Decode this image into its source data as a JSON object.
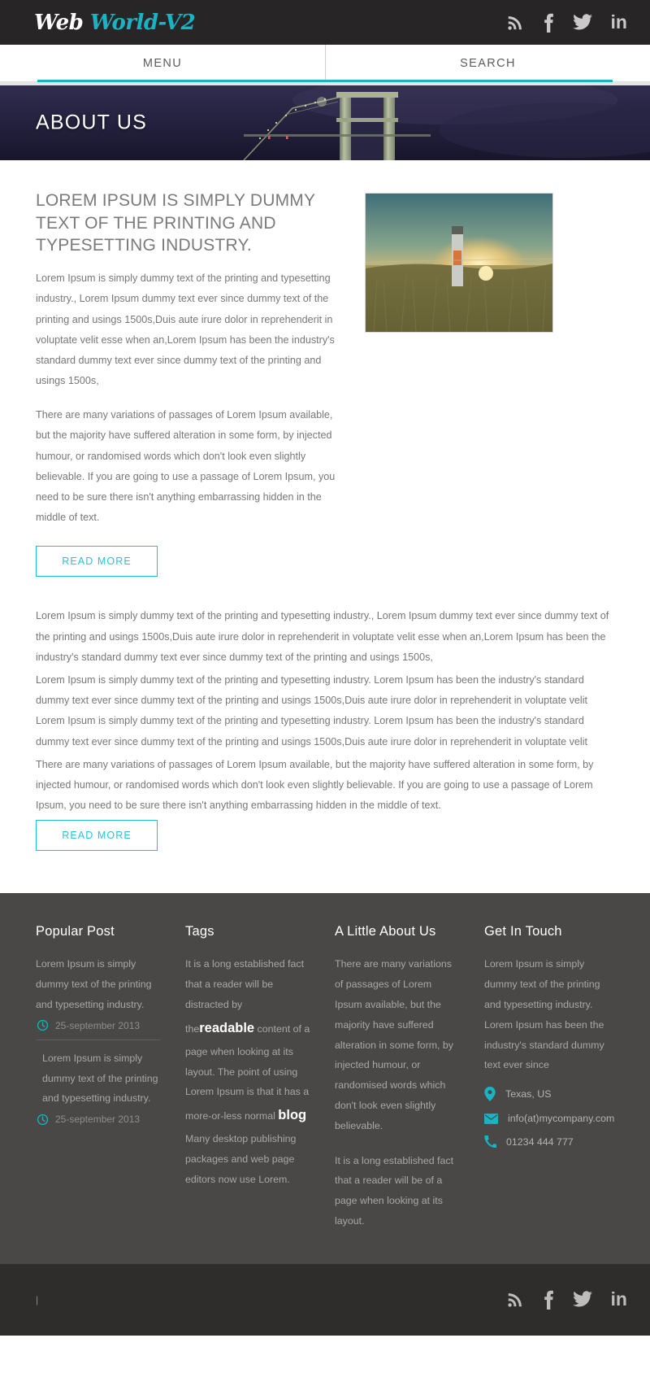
{
  "header": {
    "logo_part1": "Web ",
    "logo_part2": "World-V2",
    "social": [
      {
        "name": "rss-icon",
        "label": "RSS"
      },
      {
        "name": "facebook-icon",
        "label": "f"
      },
      {
        "name": "twitter-icon",
        "label": "Twitter"
      },
      {
        "name": "linkedin-icon",
        "label": "in"
      }
    ]
  },
  "nav": {
    "menu_label": "MENU",
    "search_label": "SEARCH",
    "accent_color": "#17b5c6"
  },
  "hero": {
    "title": "ABOUT US"
  },
  "main": {
    "headline": "LOREM IPSUM IS SIMPLY DUMMY TEXT OF THE PRINTING AND TYPESETTING INDUSTRY.",
    "paragraph1": "Lorem Ipsum is simply dummy text of the printing and typesetting industry., Lorem Ipsum dummy text ever since dummy text of the printing and usings 1500s,Duis aute irure dolor in reprehenderit in voluptate velit esse when an,Lorem Ipsum has been the industry's standard dummy text ever since dummy text of the printing and usings 1500s,",
    "paragraph2": "There are many variations of passages of Lorem Ipsum available, but the majority have suffered alteration in some form, by injected humour, or randomised words which don't look even slightly believable. If you are going to use a passage of Lorem Ipsum, you need to be sure there isn't anything embarrassing hidden in the middle of text.",
    "read_more_1": "READ MORE",
    "full_paragraph1": "Lorem Ipsum is simply dummy text of the printing and typesetting industry., Lorem Ipsum dummy text ever since dummy text of the printing and usings 1500s,Duis aute irure dolor in reprehenderit in voluptate velit esse when an,Lorem Ipsum has been the industry's standard dummy text ever since dummy text of the printing and usings 1500s,",
    "full_paragraph2": "Lorem Ipsum is simply dummy text of the printing and typesetting industry. Lorem Ipsum has been the industry's standard dummy text ever since dummy text of the printing and usings 1500s,Duis aute irure dolor in reprehenderit in voluptate velit Lorem Ipsum is simply dummy text of the printing and typesetting industry. Lorem Ipsum has been the industry's standard dummy text ever since dummy text of the printing and usings 1500s,Duis aute irure dolor in reprehenderit in voluptate velit",
    "full_paragraph3": "There are many variations of passages of Lorem Ipsum available, but the majority have suffered alteration in some form, by injected humour, or randomised words which don't look even slightly believable. If you are going to use a passage of Lorem Ipsum, you need to be sure there isn't anything embarrassing hidden in the middle of text.",
    "read_more_2": "READ MORE",
    "image_alt": "sunset-field-photo"
  },
  "footer": {
    "popular_post": {
      "title": "Popular Post",
      "items": [
        {
          "text": "Lorem Ipsum is simply dummy text of the printing and typesetting industry.",
          "date": "25-september 2013"
        },
        {
          "text": "Lorem Ipsum is simply dummy text of the printing and typesetting industry.",
          "date": "25-september 2013"
        }
      ]
    },
    "tags": {
      "title": "Tags",
      "part1": "It is a long established fact that a reader will be distracted by the",
      "highlight1": "readable",
      "part2": " content of a page when looking at its layout. The point of using Lorem Ipsum is that it has a more-or-less normal ",
      "highlight2": "blog",
      "part3": " Many desktop publishing packages and web page editors now use Lorem."
    },
    "about": {
      "title": "A Little About Us",
      "paragraph1": "There are many variations of passages of Lorem Ipsum available, but the majority have suffered alteration in some form, by injected humour, or randomised words which don't look even slightly believable.",
      "paragraph2": "It is a long established fact that a reader will be of a page when looking at its layout."
    },
    "contact": {
      "title": "Get In Touch",
      "paragraph": "Lorem Ipsum is simply dummy text of the printing and typesetting industry. Lorem Ipsum has been the industry's standard dummy text ever since",
      "location": "Texas, US",
      "email": "info(at)mycompany.com",
      "phone": "01234 444 777",
      "icon_color": "#19b3c4"
    }
  },
  "bottom": {
    "copyright": "|",
    "social": [
      {
        "name": "rss-icon",
        "label": "RSS"
      },
      {
        "name": "facebook-icon",
        "label": "f"
      },
      {
        "name": "twitter-icon",
        "label": "Twitter"
      },
      {
        "name": "linkedin-icon",
        "label": "in"
      }
    ]
  }
}
